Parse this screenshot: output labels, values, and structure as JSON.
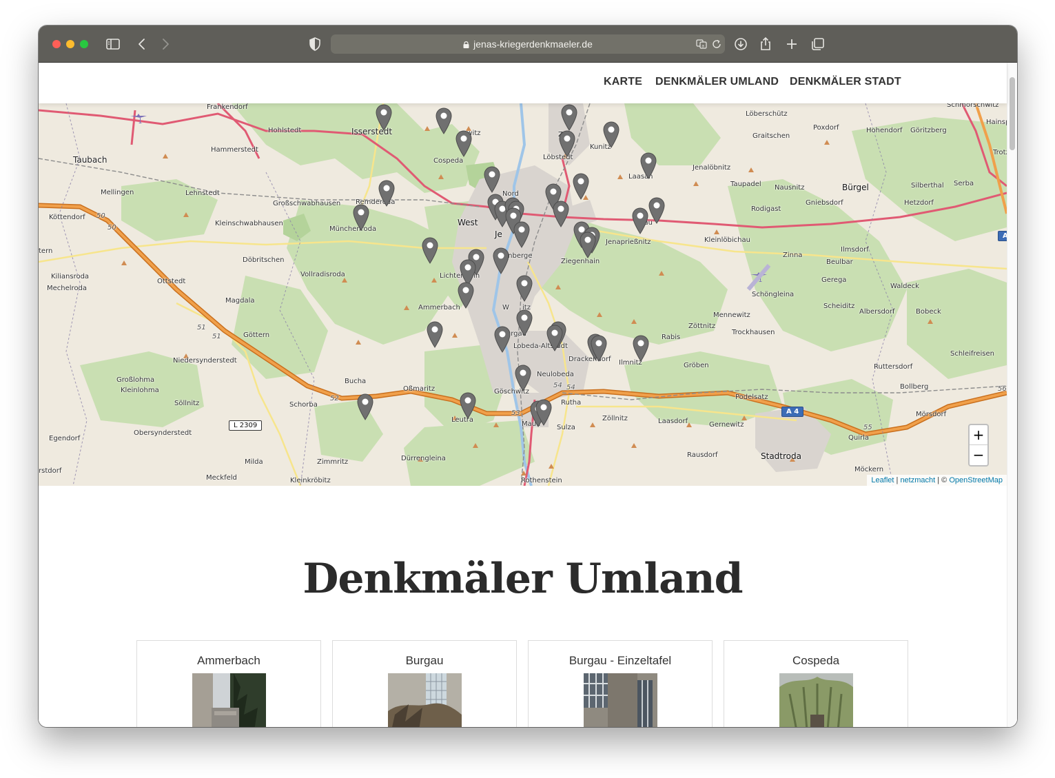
{
  "browser": {
    "url": "jenas-kriegerdenkmaeler.de"
  },
  "nav": {
    "items": [
      "KARTE",
      "DENKMÄLER UMLAND",
      "DENKMÄLER STADT"
    ]
  },
  "map": {
    "labels": {
      "frankendorf": "Frankendorf",
      "hohlstedt": "Hohlstedt",
      "isserstedt": "Isserstedt",
      "closewitz": "sewitz",
      "zwaetzen": "Zw",
      "kunitz": "Kunitz",
      "loeberschuetz": "Löberschütz",
      "poxdorf": "Poxdorf",
      "hohendorf": "Hohendorf",
      "goeritzberg": "Göritzberg",
      "schmorschwitz": "Schmorschwitz",
      "hainsp": "Hainsp",
      "taubach": "Taubach",
      "hammerstedt": "Hammerstedt",
      "cospeda": "Cospeda",
      "loebstedt": "Löbstedt",
      "graitschen": "Graitschen",
      "trotz": "Trotz",
      "mellingen": "Mellingen",
      "lehnstedt": "Lehnstedt",
      "laasan": "Laasan",
      "jenaloebnitz": "Jenalöbnitz",
      "taupadel": "Taupadel",
      "nausnitz": "Nausnitz",
      "buergel": "Bürgel",
      "silberthal": "Silberthal",
      "serba": "Serba",
      "grossschwabhausen": "Großschwabhausen",
      "remderoda": "Remderoda",
      "nord": "Nord",
      "gniebsdorf": "Gniebsdorf",
      "rodigast": "Rodigast",
      "hetzdorf": "Hetzdorf",
      "koettendorf": "Köttendorf",
      "kleinschwabhausen": "Kleinschwabhausen",
      "muenchenroda": "Münchenroda",
      "west": "West",
      "jena": "Je",
      "wogau": "ogau",
      "jenapriessnitz": "Jenaprießnitz",
      "kleinloebichau": "Kleinlöbichau",
      "ilmsdorf": "Ilmsdorf",
      "tern": "tern",
      "doebritschen": "Döbritschen",
      "kernberge": "Kernberge",
      "ziegenhain": "Ziegenhain",
      "zinna": "Zinna",
      "beulbar": "Beulbar",
      "kiliansroda": "Kiliansroda",
      "mechelroda": "Mechelroda",
      "ottstedt": "Ottstedt",
      "vollradisroda": "Vollradisroda",
      "lichtenhain": "Lichtenhain",
      "gerega": "Gerega",
      "waldeck": "Waldeck",
      "magdala": "Magdala",
      "ammerbach": "Ammerbach",
      "winzerla": "W",
      "winzerla2": "itz",
      "schoengleina": "Schöngleina",
      "scheiditz": "Scheiditz",
      "albersdorf": "Albersdorf",
      "bobeck": "Bobeck",
      "goettern": "Göttern",
      "burgau": "Burgau",
      "mennewitz": "Mennewitz",
      "zoettnitz": "Zöttnitz",
      "trockhausen": "Trockhausen",
      "rabis": "Rabis",
      "lobeda_altstadt": "Lobeda-Altstadt",
      "schleifreisen": "Schleifreisen",
      "niedersynderstedt": "Niedersynderstedt",
      "drackendorf": "Drackendorf",
      "ilmnitz": "Ilmnitz",
      "groeben": "Gröben",
      "grosslohma": "Großlohma",
      "kleinlohma": "Kleinlohma",
      "neulobeda": "Neulobeda",
      "ruttersdorf": "Ruttersdorf",
      "bucha": "Bucha",
      "ossmaritz": "Oßmaritz",
      "goeschwitz": "Göschwitz",
      "bollberg": "Bollberg",
      "soellnitz": "Söllnitz",
      "schorba": "Schorba",
      "ruetha": "Rutha",
      "podelsatz": "Podelsatz",
      "moersdorf": "Mörsdorf",
      "leutra": "Leutra",
      "maua": "Maua",
      "zoellnitz": "Zöllnitz",
      "laasdorf": "Laasdorf",
      "gernewitz": "Gernewitz",
      "sulza": "Sulza",
      "quirla": "Quirla",
      "egendorf": "Egendorf",
      "obersynderstedt": "Obersynderstedt",
      "stadtroda": "Stadtroda",
      "rausdorf": "Rausdorf",
      "duerrengleina": "Dürrengleina",
      "milda": "Milda",
      "zimmritz": "Zimmritz",
      "moeckern": "Möckern",
      "rstdorf": "rstdorf",
      "meckfeld": "Meckfeld",
      "kleinkroebitz": "Kleinkröbitz",
      "rothenstein": "Rothenstein"
    },
    "shields": {
      "l2309": "L 2309",
      "a4": "A 4",
      "a4b": "A",
      "ex50a": "50",
      "ex50b": "50",
      "ex51a": "51",
      "ex51b": "51",
      "ex52": "52",
      "ex53": "53",
      "ex54a": "54",
      "ex54b": "54",
      "ex55": "55",
      "ex56": "56"
    },
    "zoom_in": "+",
    "zoom_out": "−",
    "attribution": {
      "leaflet": "Leaflet",
      "sep1": "|",
      "netzmacht": "netzmacht",
      "sep2": "| ©",
      "osm": "OpenStreetMap"
    },
    "colors": {
      "marker": "#707070",
      "motorway": "#e8923a",
      "primary_road": "#e05a73",
      "forest": "#c9dfb2",
      "urban": "#d9d4cf",
      "river": "#9fc5e8"
    }
  },
  "section": {
    "title": "Denkmäler Umland"
  },
  "cards": [
    {
      "title": "Ammerbach"
    },
    {
      "title": "Burgau"
    },
    {
      "title": "Burgau - Einzeltafel"
    },
    {
      "title": "Cospeda"
    }
  ]
}
